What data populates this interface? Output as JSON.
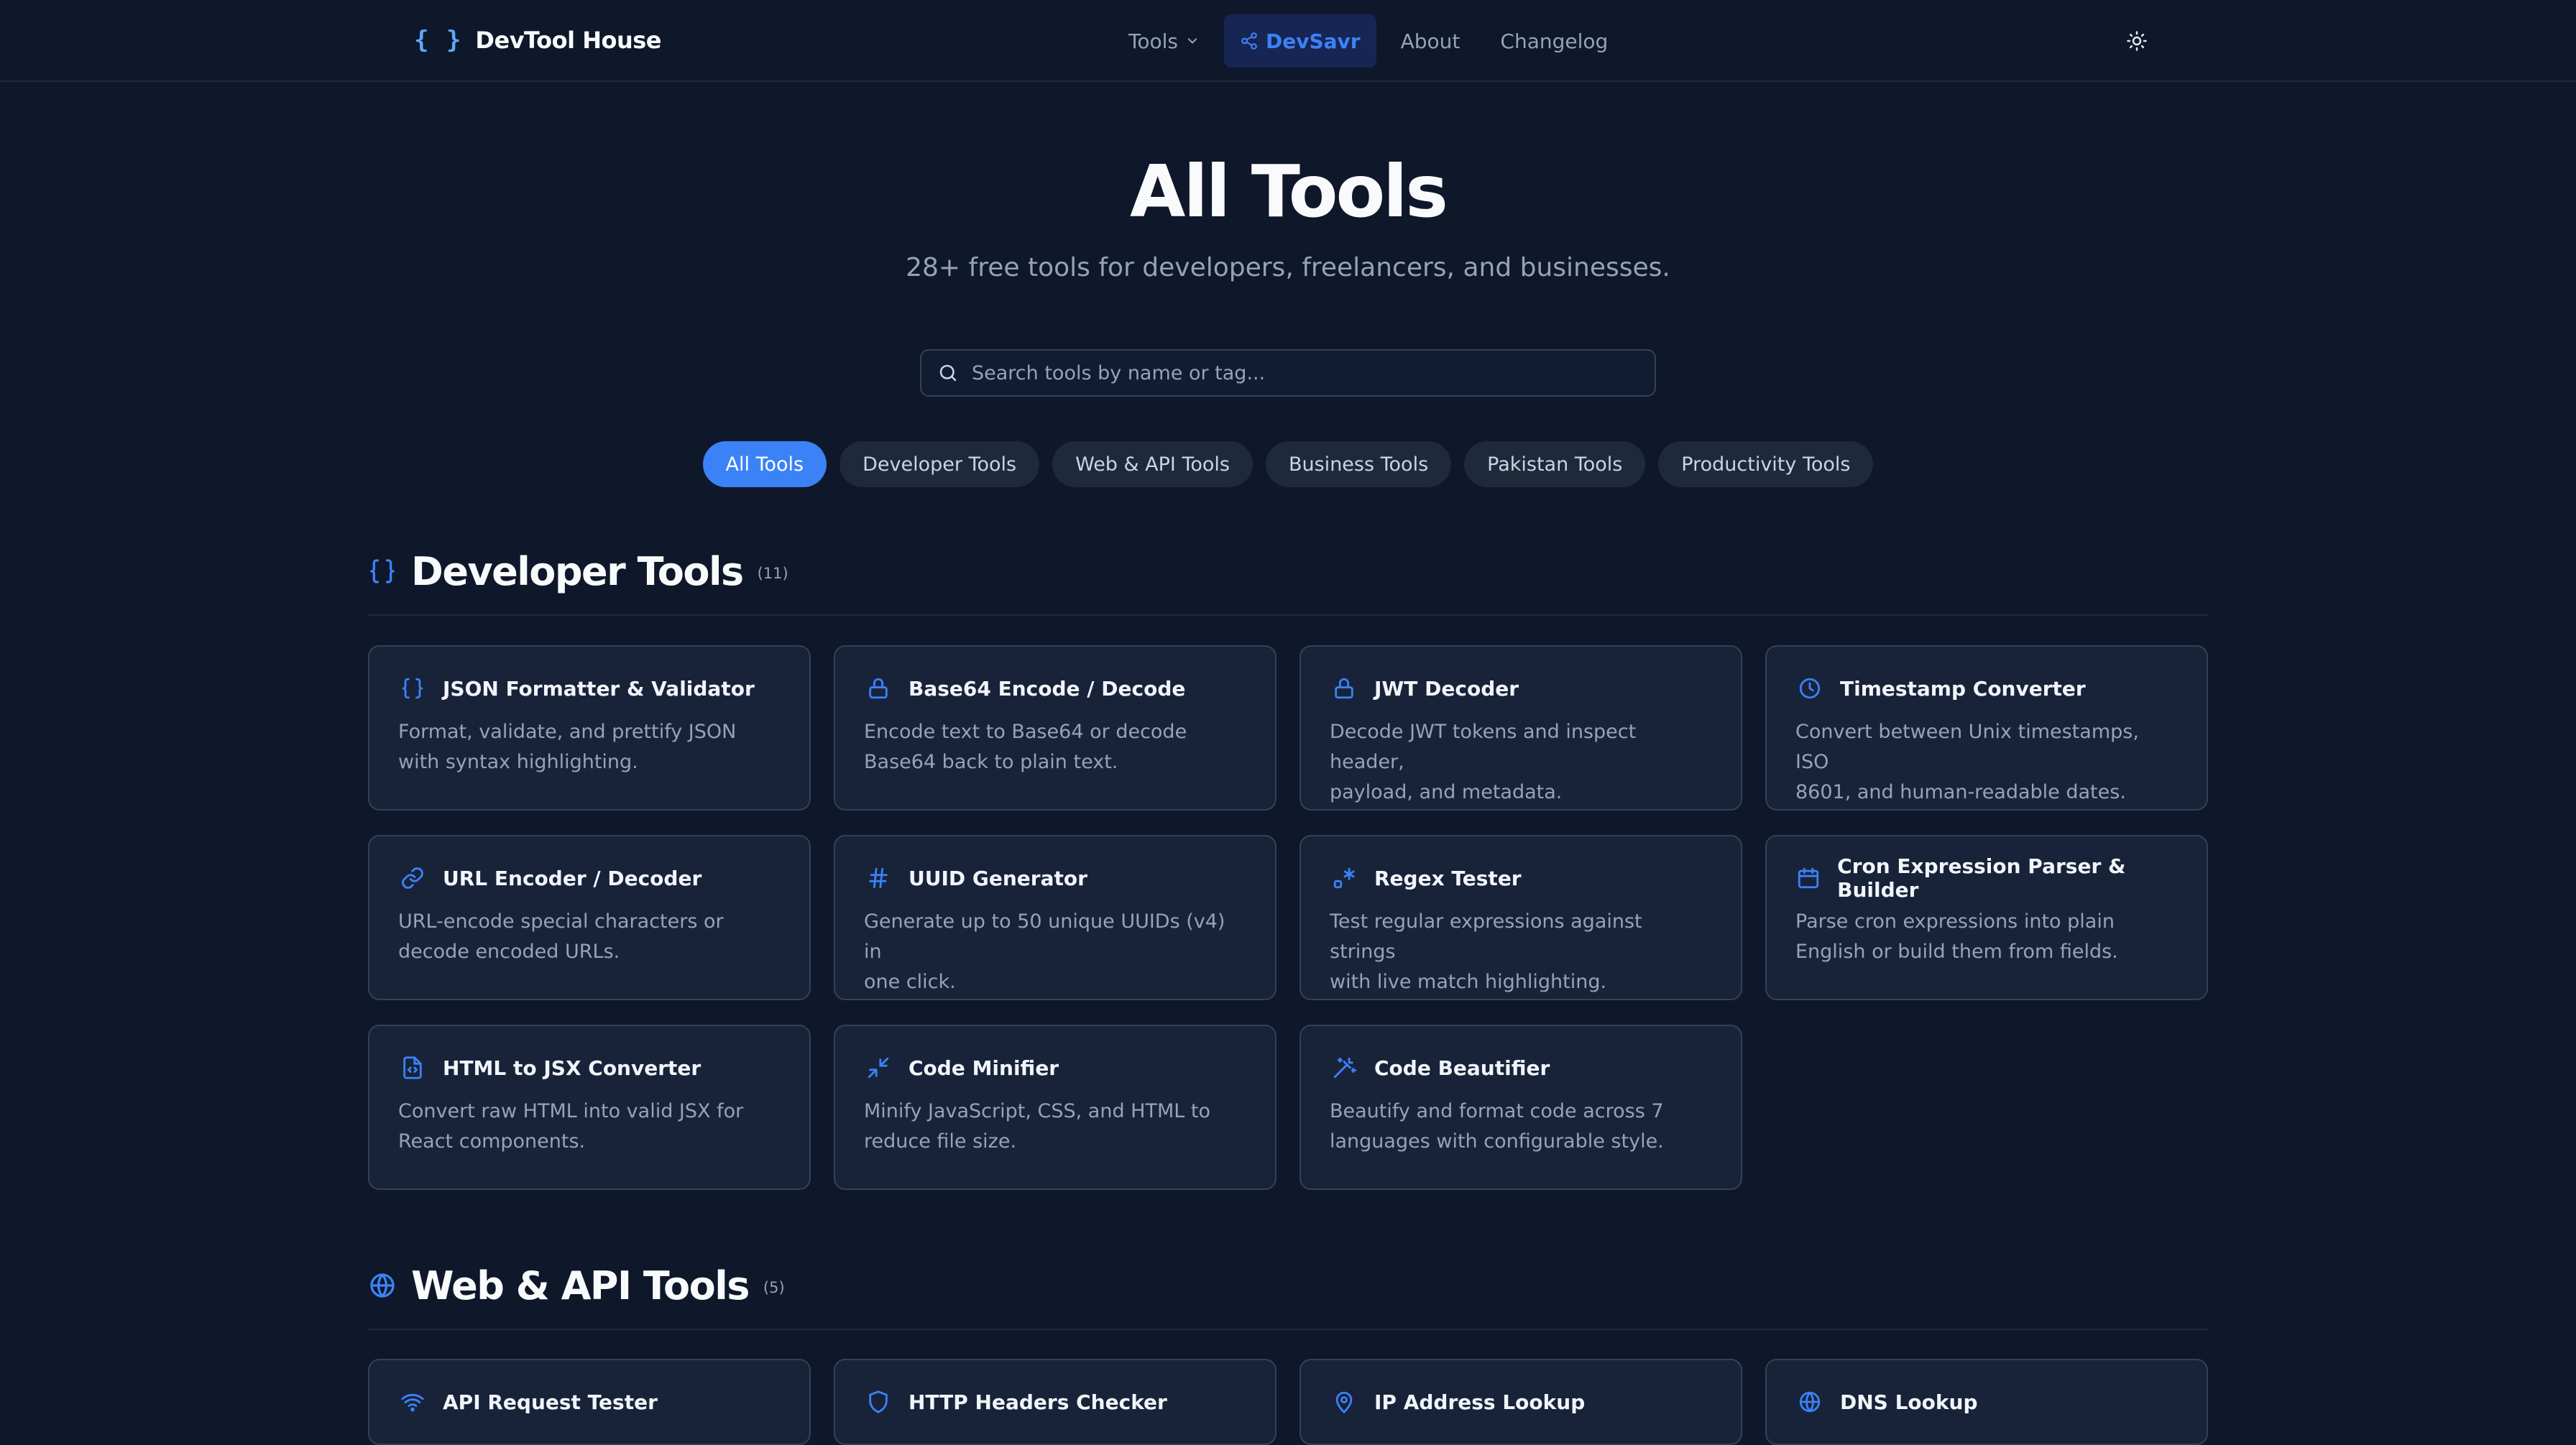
{
  "header": {
    "logo": "{ }",
    "brand": "DevTool House",
    "nav": [
      {
        "label": "Tools"
      },
      {
        "label": "DevSavr"
      },
      {
        "label": "About"
      },
      {
        "label": "Changelog"
      }
    ]
  },
  "hero": {
    "title": "All Tools",
    "subtitle": "28+ free tools for developers, freelancers, and businesses.",
    "search_placeholder": "Search tools by name or tag..."
  },
  "filters": [
    "All Tools",
    "Developer Tools",
    "Web & API Tools",
    "Business Tools",
    "Pakistan Tools",
    "Productivity Tools"
  ],
  "sections": [
    {
      "title": "Developer Tools",
      "count": "(11)",
      "tools": [
        {
          "name": "JSON Formatter & Validator",
          "desc_1": "Format, validate, and prettify JSON",
          "desc_2": "with syntax highlighting.",
          "icon": "braces-icon"
        },
        {
          "name": "Base64 Encode / Decode",
          "desc_1": "Encode text to Base64 or decode",
          "desc_2": "Base64 back to plain text.",
          "icon": "lock-icon"
        },
        {
          "name": "JWT Decoder",
          "desc_1": "Decode JWT tokens and inspect header,",
          "desc_2": "payload, and metadata.",
          "icon": "lock-icon"
        },
        {
          "name": "Timestamp Converter",
          "desc_1": "Convert between Unix timestamps, ISO",
          "desc_2": "8601, and human-readable dates.",
          "icon": "clock-icon"
        },
        {
          "name": "URL Encoder / Decoder",
          "desc_1": "URL-encode special characters or",
          "desc_2": "decode encoded URLs.",
          "icon": "link-icon"
        },
        {
          "name": "UUID Generator",
          "desc_1": "Generate up to 50 unique UUIDs (v4) in",
          "desc_2": "one click.",
          "icon": "hash-icon"
        },
        {
          "name": "Regex Tester",
          "desc_1": "Test regular expressions against strings",
          "desc_2": "with live match highlighting.",
          "icon": "regex-icon"
        },
        {
          "name": "Cron Expression Parser & Builder",
          "desc_1": "Parse cron expressions into plain",
          "desc_2": "English or build them from fields.",
          "icon": "calendar-icon"
        },
        {
          "name": "HTML to JSX Converter",
          "desc_1": "Convert raw HTML into valid JSX for",
          "desc_2": "React components.",
          "icon": "file-code-icon"
        },
        {
          "name": "Code Minifier",
          "desc_1": "Minify JavaScript, CSS, and HTML to",
          "desc_2": "reduce file size.",
          "icon": "minimize-icon"
        },
        {
          "name": "Code Beautifier",
          "desc_1": "Beautify and format code across 7",
          "desc_2": "languages with configurable style.",
          "icon": "wand-icon"
        }
      ]
    },
    {
      "title": "Web & API Tools",
      "count": "(5)",
      "tools": [
        {
          "name": "API Request Tester",
          "icon": "wifi-icon"
        },
        {
          "name": "HTTP Headers Checker",
          "icon": "shield-icon"
        },
        {
          "name": "IP Address Lookup",
          "icon": "map-pin-icon"
        },
        {
          "name": "DNS Lookup",
          "icon": "globe-icon"
        }
      ]
    }
  ],
  "colors": {
    "background": "#0f172a",
    "card": "#18233a",
    "accent": "#3b82f6",
    "muted": "#94a3b8"
  }
}
